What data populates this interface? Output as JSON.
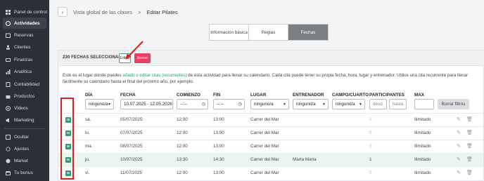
{
  "sidebar": {
    "items": [
      {
        "label": "Panel de control",
        "icon": "dashboard-icon"
      },
      {
        "label": "Actividades",
        "icon": "activities-icon",
        "active": true
      },
      {
        "label": "Reservas",
        "icon": "bookings-icon"
      },
      {
        "label": "Clientes",
        "icon": "clients-icon"
      },
      {
        "label": "Finanzas",
        "icon": "finance-icon"
      },
      {
        "label": "Analítica",
        "icon": "analytics-icon"
      },
      {
        "label": "Contabilidad",
        "icon": "accounting-icon"
      },
      {
        "label": "Productos",
        "icon": "products-icon"
      },
      {
        "label": "Videos",
        "icon": "video-icon"
      },
      {
        "label": "Marketing",
        "icon": "marketing-icon"
      },
      {
        "label": "Ocultar",
        "icon": "hide-icon"
      },
      {
        "label": "Ajustes",
        "icon": "settings-icon"
      },
      {
        "label": "Market",
        "icon": "market-icon"
      },
      {
        "label": "Tu bonus",
        "icon": "bonus-icon"
      }
    ]
  },
  "breadcrumb": {
    "back": "‹",
    "parent": "Vista global de las clases",
    "sep": ">",
    "current": "Editar Pilates"
  },
  "tabs": [
    {
      "label": "Información básica"
    },
    {
      "label": "Reglas"
    },
    {
      "label": "Fechas",
      "selected": true
    }
  ],
  "card": {
    "count": "230 FECHAS SELECCIONADAS",
    "edit": "Editar",
    "delete": "Borrar",
    "desc_1": "Este es el lugar donde puedes ",
    "desc_link": "añadir o editar citas (recurrentes)",
    "desc_2": " de esta actividad para llenar su calendario. Cada cita puede tener su propia fecha, hora, lugar y entrenador. Utilice una cita recurrente para llenar fácilmente su calendario hasta el final del próximo año, por ejemplo."
  },
  "columns": {
    "day": "DÍA",
    "date": "FECHA",
    "start": "COMIENZO",
    "end": "FIN",
    "place": "LUGAR",
    "trainer": "ENTRENADOR",
    "field": "CAMPO/CUARTO",
    "participants": "PARTICIPANTES",
    "max": "MAX"
  },
  "filters": {
    "day": "ninguno/a",
    "date": "10.07.2025 - 12.05.2026",
    "start": "--:--",
    "end": "--:--",
    "place": "ninguno/a",
    "trainer": "ninguno/a",
    "field": "ninguno/a",
    "from": "desd.",
    "to": "hasta",
    "clear": "Borrar filtros"
  },
  "rows": [
    {
      "day": "sá.",
      "date": "05/07/2025",
      "start": "12:00",
      "end": "13:00",
      "place": "Carrer del Mar",
      "trainer": "",
      "participants": "0",
      "max": "Ilimitado"
    },
    {
      "day": "lu.",
      "date": "07/07/2025",
      "start": "12:00",
      "end": "13:00",
      "place": "Carrer del Mar",
      "trainer": "",
      "participants": "0",
      "max": "Ilimitado"
    },
    {
      "day": "ma.",
      "date": "08/07/2025",
      "start": "12:00",
      "end": "13:00",
      "place": "Carrer del Mar",
      "trainer": "",
      "participants": "0",
      "max": "Ilimitado"
    },
    {
      "day": "ju.",
      "date": "10/07/2025",
      "start": "13:30",
      "end": "14:30",
      "place": "Carrer del Mar",
      "trainer": "Marta Maria",
      "participants": "1",
      "max": "Ilimitado",
      "highlight": true
    },
    {
      "day": "vi.",
      "date": "11/07/2025",
      "start": "12:00",
      "end": "13:00",
      "place": "Carrer del Mar",
      "trainer": "",
      "participants": "0",
      "max": "Ilimitado"
    }
  ],
  "colors": {
    "accent": "#2e9e72",
    "danger": "#e64164",
    "annotation": "#e02020",
    "sidebar": "#2b2f36"
  }
}
